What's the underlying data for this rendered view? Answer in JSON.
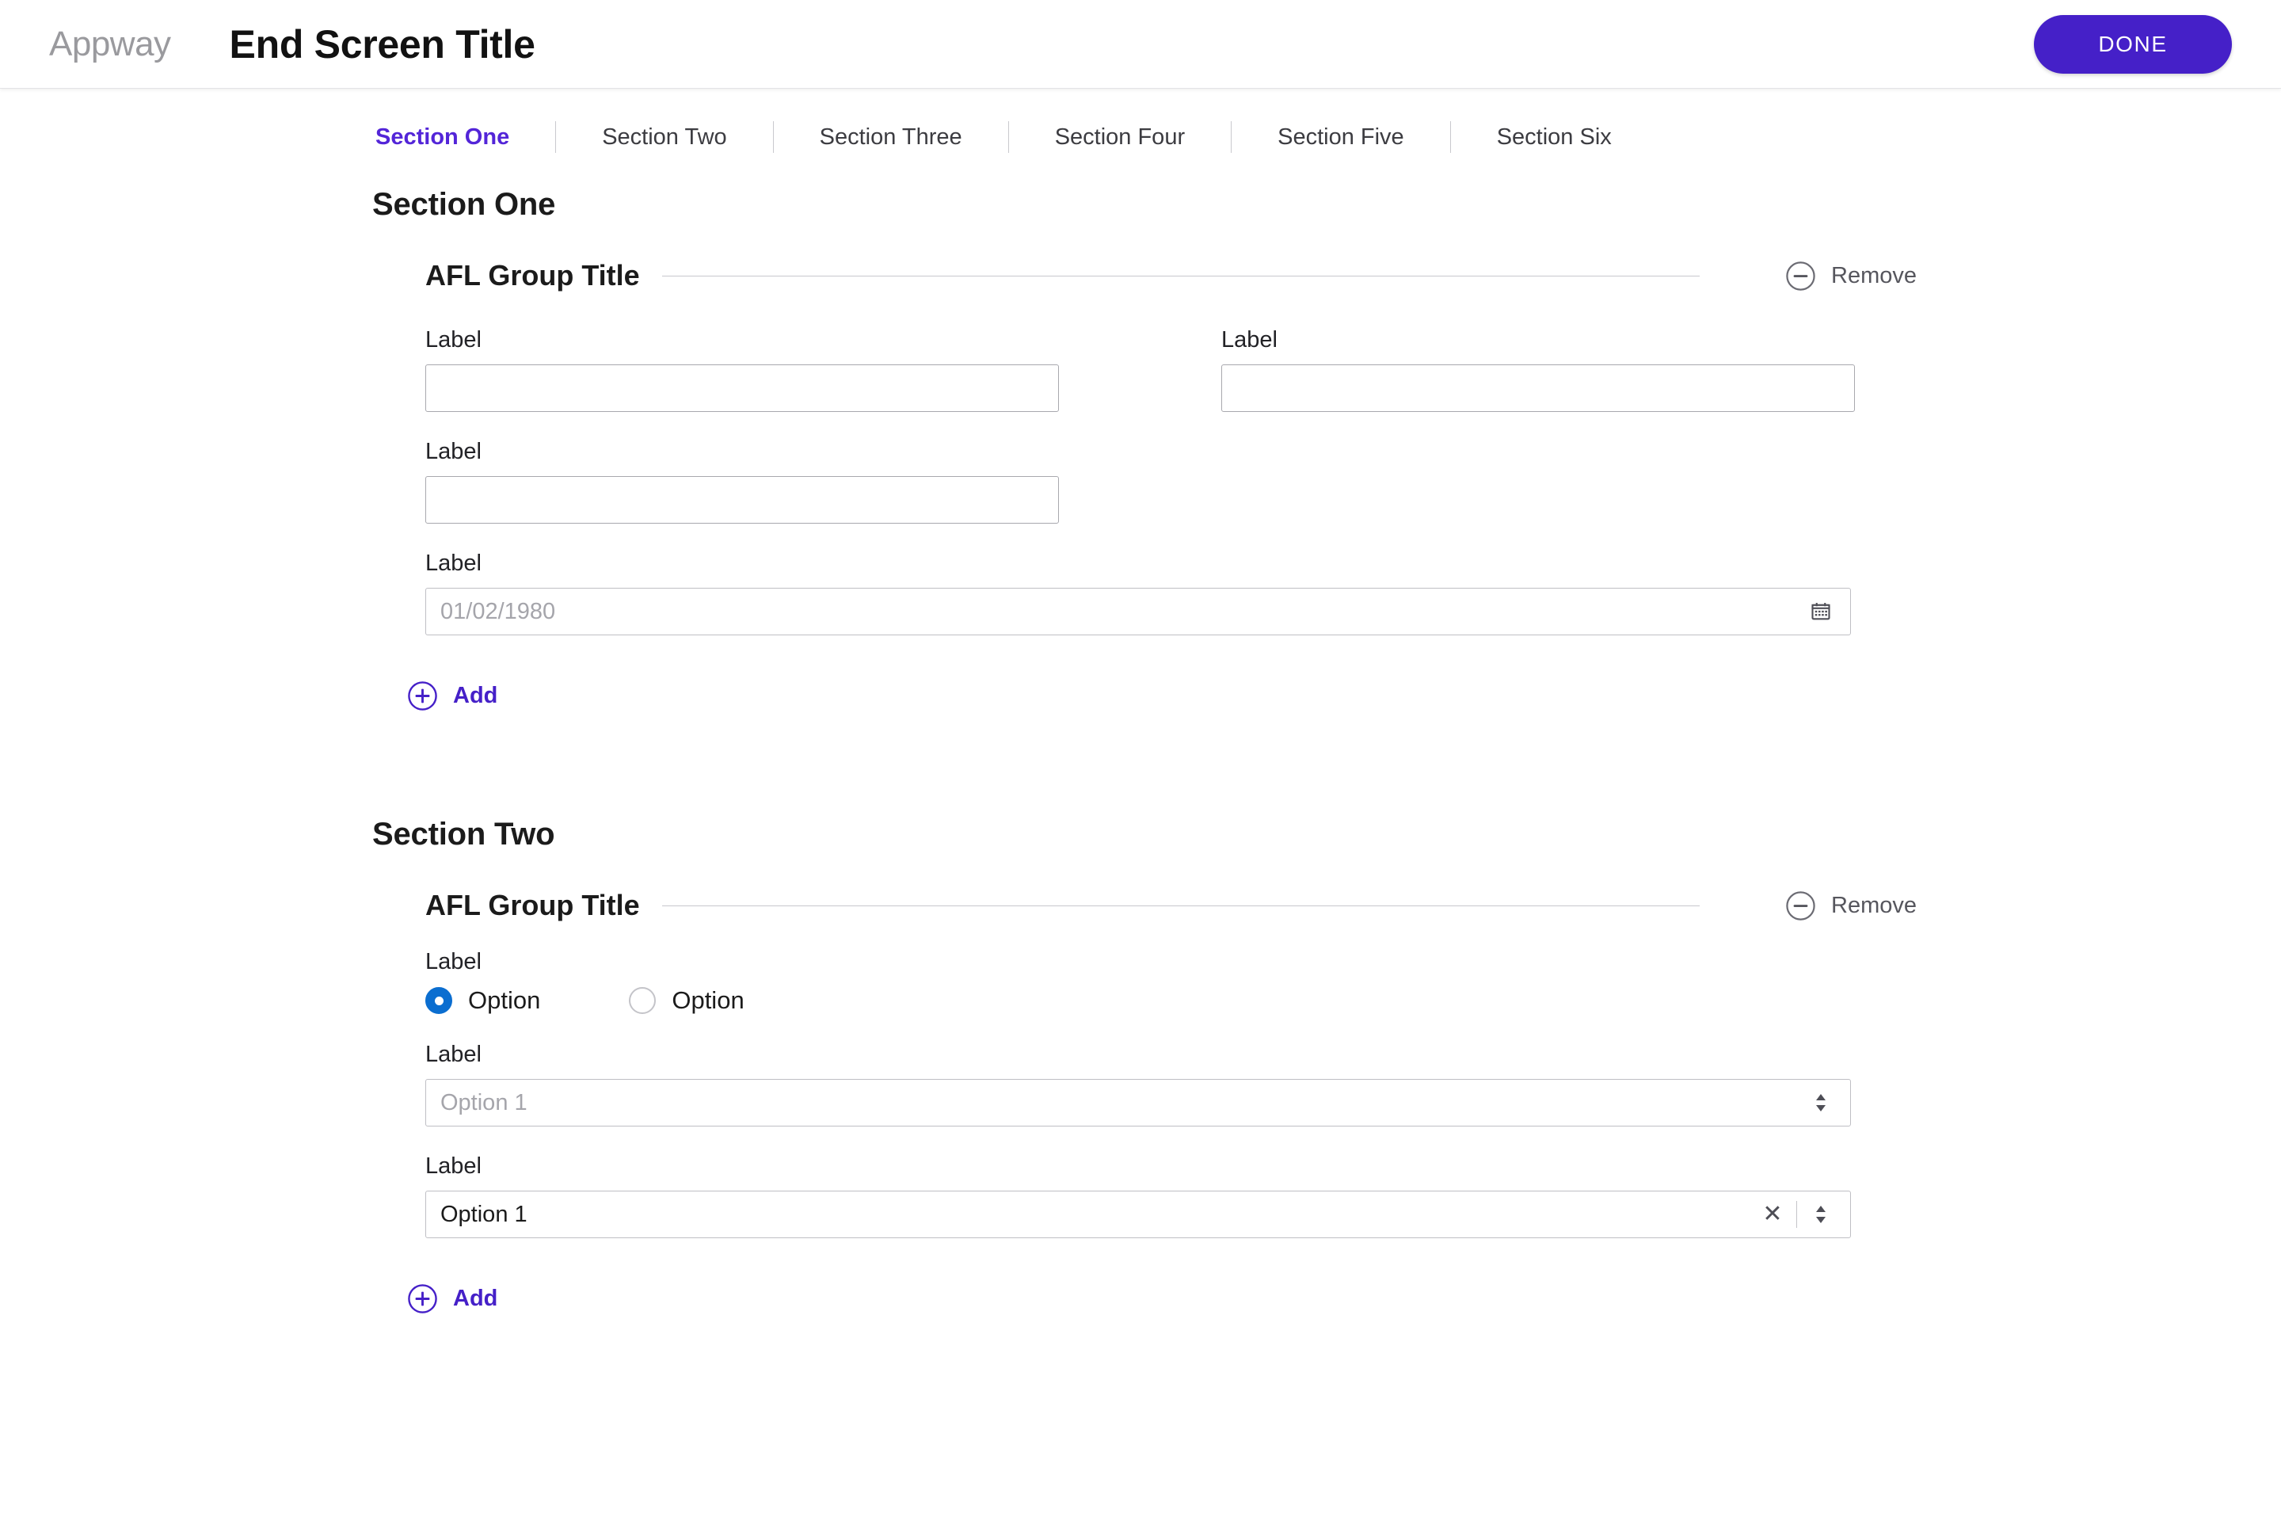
{
  "header": {
    "brand": "Appway",
    "title": "End Screen Title",
    "done_label": "DONE"
  },
  "tabs": [
    {
      "label": "Section One",
      "active": true
    },
    {
      "label": "Section Two",
      "active": false
    },
    {
      "label": "Section Three",
      "active": false
    },
    {
      "label": "Section Four",
      "active": false
    },
    {
      "label": "Section Five",
      "active": false
    },
    {
      "label": "Section Six",
      "active": false
    }
  ],
  "icons": {
    "remove": "circle-minus-icon",
    "add": "circle-plus-icon",
    "calendar": "calendar-icon",
    "clear": "clear-x-icon",
    "stepper": "stepper-arrows-icon"
  },
  "colors": {
    "accent_purple": "#4520c8",
    "tab_active": "#5325d8",
    "radio_blue": "#0b6ed0",
    "icon_gray": "#56565d",
    "border_gray": "#a8a8ae"
  },
  "section_one": {
    "heading": "Section One",
    "group_title": "AFL Group Title",
    "remove_label": "Remove",
    "add_label": "Add",
    "field_1_label": "Label",
    "field_1_value": "",
    "field_2_label": "Label",
    "field_2_value": "",
    "field_3_label": "Label",
    "field_3_value": "",
    "date_label": "Label",
    "date_placeholder": "01/02/1980",
    "date_value": ""
  },
  "section_two": {
    "heading": "Section Two",
    "group_title": "AFL Group Title",
    "remove_label": "Remove",
    "add_label": "Add",
    "radio_label": "Label",
    "radio_option_1": "Option",
    "radio_option_2": "Option",
    "select_1_label": "Label",
    "select_1_placeholder": "Option 1",
    "select_1_value": "",
    "select_2_label": "Label",
    "select_2_value": "Option 1"
  }
}
